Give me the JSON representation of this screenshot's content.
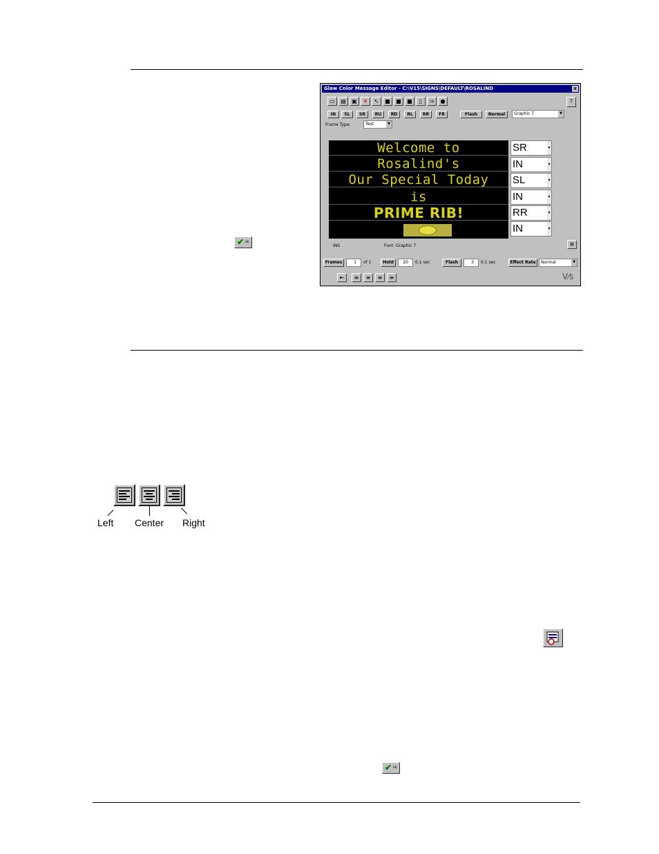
{
  "editor": {
    "title": "Glaw Color Message Editor - C:\\V15\\SIGNS\\DEFAULT\\ROSALIND",
    "close_label": "x",
    "help_label": "?",
    "effect_buttons": [
      "IN",
      "SL",
      "SR",
      "RU",
      "RD",
      "RL",
      "RR",
      "FR"
    ],
    "flash_label": "Flash",
    "normal_label": "Normal",
    "graphic_select": "Graphic 7",
    "frame_type_label": "Frame Type:",
    "frame_type_value": "Text",
    "sign_lines": [
      "Welcome to",
      "Rosalind's",
      "Our Special Today",
      "is",
      "PRIME RIB!"
    ],
    "line_effects": [
      "SR",
      "IN",
      "SL",
      "IN",
      "RR",
      "IN"
    ],
    "status_left": "INS",
    "status_font": "Font: Graphic 7",
    "frames_label": "Frames",
    "frames_value": "1",
    "frames_unit": "of 1",
    "hold_label": "Hold",
    "hold_value": "20",
    "hold_unit": "0.1 sec",
    "flash_rate_label": "Flash",
    "flash_rate_value": "3",
    "flash_rate_unit": "0.1 sec",
    "effect_rate_label": "Effect Rate",
    "effect_rate_value": "Normal"
  },
  "alignment": {
    "left_label": "Left",
    "center_label": "Center",
    "right_label": "Right"
  },
  "ok_label": "ok",
  "colors": {
    "sign_text": "#d8d020",
    "title_bar": "#000080",
    "check": "#008000"
  }
}
